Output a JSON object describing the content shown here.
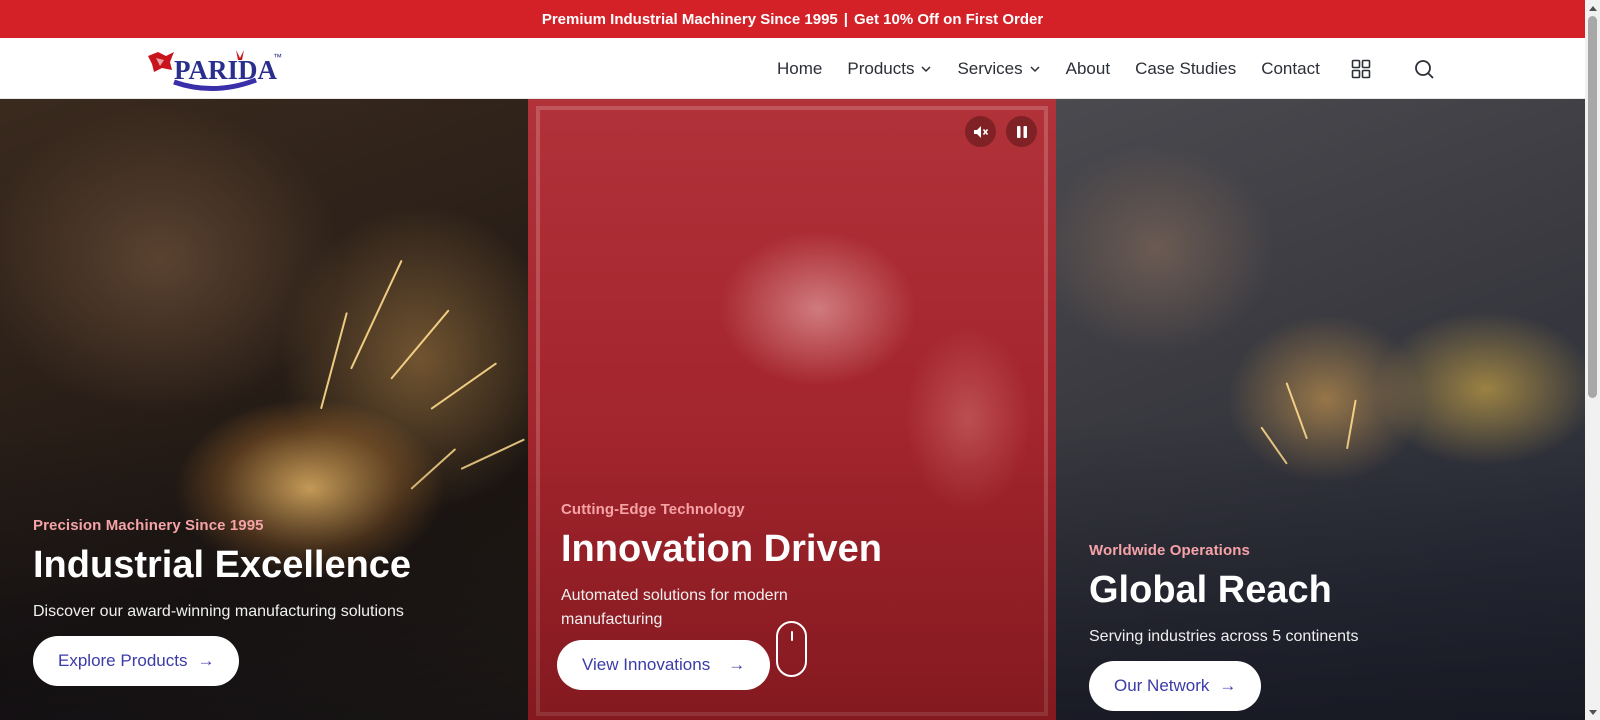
{
  "promo": {
    "text_left": "Premium Industrial Machinery Since 1995",
    "separator": "|",
    "text_right": "Get 10% Off on First Order",
    "bg_color": "#d42128"
  },
  "header": {
    "logo_text": "PARIDA",
    "logo_tm": "™",
    "nav": [
      {
        "label": "Home"
      },
      {
        "label": "Products",
        "has_dropdown": true
      },
      {
        "label": "Services",
        "has_dropdown": true
      },
      {
        "label": "About"
      },
      {
        "label": "Case Studies"
      },
      {
        "label": "Contact"
      }
    ],
    "icons": [
      "grid-icon",
      "search-icon"
    ]
  },
  "hero": {
    "panels": [
      {
        "eyebrow": "Precision Machinery Since 1995",
        "title": "Industrial Excellence",
        "description": "Discover our award-winning manufacturing solutions",
        "cta": "Explore Products",
        "arrow": "→"
      },
      {
        "eyebrow": "Cutting-Edge Technology",
        "title": "Innovation Driven",
        "description": "Automated solutions for modern manufacturing",
        "cta": "View Innovations",
        "arrow": "→",
        "media_controls": [
          "mute-icon",
          "pause-icon"
        ]
      },
      {
        "eyebrow": "Worldwide Operations",
        "title": "Global Reach",
        "description": "Serving industries across 5 continents",
        "cta": "Our Network",
        "arrow": "→"
      }
    ]
  },
  "colors": {
    "accent_red": "#d42128",
    "cta_text": "#3b3ba8",
    "eyebrow": "#f6a3a8"
  }
}
